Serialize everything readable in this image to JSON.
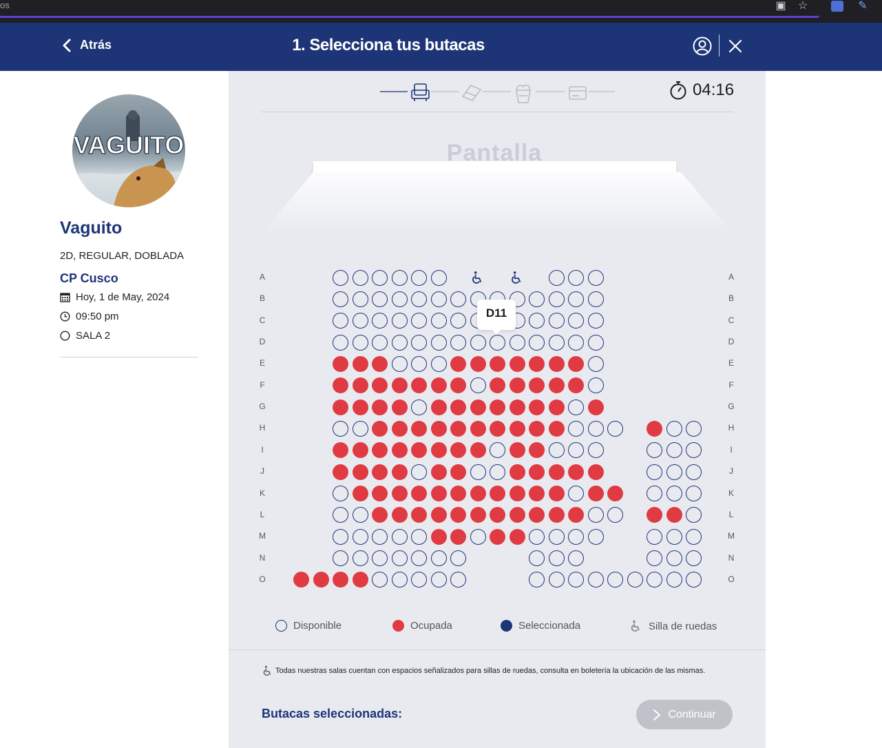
{
  "browser": {
    "os_text": "os"
  },
  "header": {
    "back_label": "Atrás",
    "title": "1. Selecciona tus butacas"
  },
  "movie": {
    "poster_title": "VAGUITO",
    "title": "Vaguito",
    "format": "2D, REGULAR, DOBLADA",
    "cinema": "CP Cusco",
    "date": "Hoy, 1 de May, 2024",
    "time": "09:50 pm",
    "room": "SALA 2"
  },
  "timer": "04:16",
  "screen_label": "Pantalla",
  "row_labels": [
    "A",
    "B",
    "C",
    "D",
    "E",
    "F",
    "G",
    "H",
    "I",
    "J",
    "K",
    "L",
    "M",
    "N",
    "O"
  ],
  "seat_legend": {
    "codes": "a = disponible, o = ocupada, w = silla de ruedas, . = sin butaca",
    "rows": {
      "A": "....aaaaaa.w.w.aaa.....",
      "B": "....aaaaaaaaaaaaaa.....",
      "C": "....aaaaaaaaaaaaaa.....",
      "D": "....aaaaaaaaaaaaaa.....",
      "E": "....oooaaaoooooooa.....",
      "F": "....oooooooaoooooa.....",
      "G": "....ooooaoooooooao.....",
      "H": "....aaooooooooooaaa.oaa",
      "I": "....ooooooooaooaaa..aaa",
      "J": "....ooooaooaaooooo..aaa",
      "K": "....aoooooooooooaoo.aaa",
      "L": "....aaoooooooooooaa.ooa",
      "M": "....aaaaaooaooaaaa..aaa",
      "N": "....aaaaaaa...aaa...aaa",
      "O": "..ooooaaaaa...aaaaaaaaa"
    }
  },
  "tooltip_seat": "D11",
  "legend": {
    "available": "Disponible",
    "occupied": "Ocupada",
    "selected": "Seleccionada",
    "wheelchair": "Silla de ruedas"
  },
  "colors": {
    "brand": "#1d3577",
    "occupied": "#e03a42",
    "button_disabled": "#bfc2c8",
    "panel_bg": "#e8eaf0"
  },
  "note": "Todas nuestras salas cuentan con espacios señalizados para sillas de ruedas, consulta en boletería la ubicación de las mismas.",
  "footer": {
    "selected_label": "Butacas seleccionadas:",
    "continue_label": "Continuar"
  }
}
